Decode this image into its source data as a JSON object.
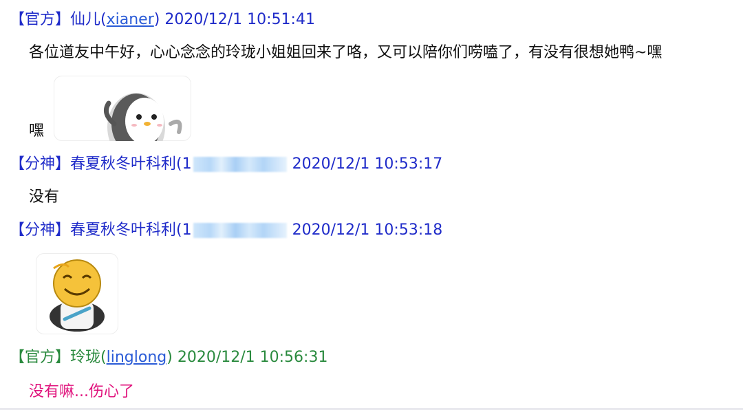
{
  "messages": [
    {
      "role": "【官方】",
      "nickname": "仙儿",
      "paren_open": "(",
      "username": "xianer",
      "paren_close": ")",
      "timestamp": "2020/12/1 10:51:41",
      "text": "各位道友中午好，心心念念的玲珑小姐姐回来了咯，又可以陪你们唠嗑了，有没有很想她鸭~嘿",
      "text_cont": "嘿",
      "sticker": "penguin-sticker"
    },
    {
      "role": "【分神】",
      "nickname": "春夏秋冬叶科利",
      "paren_open": "(",
      "username_visible": "1",
      "timestamp": "2020/12/1 10:53:17",
      "text": "没有"
    },
    {
      "role": "【分神】",
      "nickname": "春夏秋冬叶科利",
      "paren_open": "(",
      "username_visible": "1",
      "timestamp": "2020/12/1 10:53:18",
      "sticker": "smiley-sticker"
    },
    {
      "role": "【官方】",
      "nickname": "玲珑",
      "paren_open": "(",
      "username": "linglong",
      "paren_close": ")",
      "timestamp": "2020/12/1 10:56:31",
      "text": "没有嘛...伤心了"
    }
  ],
  "colors": {
    "role_blue": "#1f2bc9",
    "role_green": "#2a8a3e",
    "link": "#2a5bd7",
    "pink_text": "#e0127c"
  }
}
